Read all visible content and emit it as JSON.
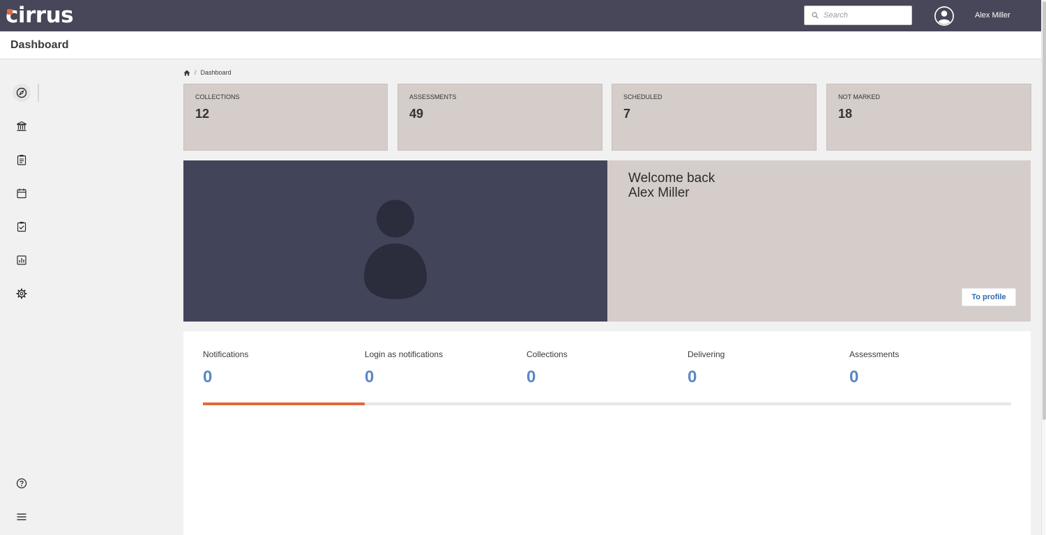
{
  "topbar": {
    "logo_text": "cirrus",
    "search_placeholder": "Search",
    "user_name": "Alex Miller"
  },
  "page": {
    "title": "Dashboard"
  },
  "breadcrumb": {
    "current": "Dashboard",
    "separator": "/"
  },
  "sidebar": {
    "items": [
      {
        "icon": "compass-icon",
        "active": true
      },
      {
        "icon": "institution-icon"
      },
      {
        "icon": "clipboard-icon"
      },
      {
        "icon": "calendar-icon"
      },
      {
        "icon": "checklist-icon"
      },
      {
        "icon": "chart-icon"
      },
      {
        "icon": "gear-icon"
      }
    ],
    "bottom_items": [
      {
        "icon": "help-icon"
      },
      {
        "icon": "menu-icon"
      }
    ]
  },
  "stats": [
    {
      "label": "COLLECTIONS",
      "value": "12"
    },
    {
      "label": "ASSESSMENTS",
      "value": "49"
    },
    {
      "label": "SCHEDULED",
      "value": "7"
    },
    {
      "label": "NOT MARKED",
      "value": "18"
    }
  ],
  "welcome": {
    "line1": "Welcome back",
    "line2": "Alex Miller",
    "profile_button": "To profile"
  },
  "notifications": {
    "tabs": [
      {
        "label": "Notifications",
        "count": "0",
        "active": true
      },
      {
        "label": "Login as notifications",
        "count": "0"
      },
      {
        "label": "Collections",
        "count": "0"
      },
      {
        "label": "Delivering",
        "count": "0"
      },
      {
        "label": "Assessments",
        "count": "0"
      }
    ],
    "progress_fraction": 0.2
  },
  "colors": {
    "topbar": "#484659",
    "card": "#d5cdca",
    "accent": "#e2693a",
    "link": "#2d6bb0",
    "count": "#5b87c5"
  }
}
